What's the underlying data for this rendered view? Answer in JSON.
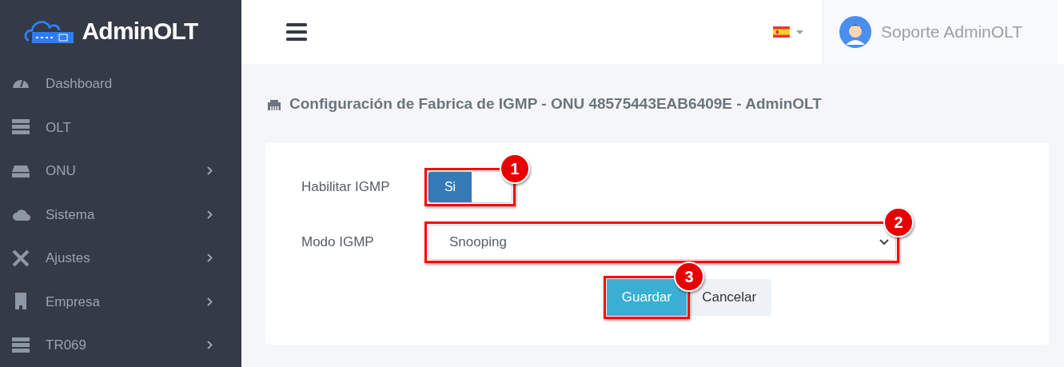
{
  "brand": {
    "name": "AdminOLT"
  },
  "sidebar": {
    "items": [
      {
        "label": "Dashboard",
        "has_submenu": false
      },
      {
        "label": "OLT",
        "has_submenu": false
      },
      {
        "label": "ONU",
        "has_submenu": true
      },
      {
        "label": "Sistema",
        "has_submenu": true
      },
      {
        "label": "Ajustes",
        "has_submenu": true
      },
      {
        "label": "Empresa",
        "has_submenu": true
      },
      {
        "label": "TR069",
        "has_submenu": true
      }
    ]
  },
  "header": {
    "user": "Soporte AdminOLT"
  },
  "page": {
    "title": "Configuración de Fabrica de IGMP - ONU 48575443EAB6409E - AdminOLT"
  },
  "form": {
    "enable": {
      "label": "Habilitar IGMP",
      "on": true,
      "on_text": "Si",
      "annotation": "1"
    },
    "mode": {
      "label": "Modo IGMP",
      "value": "Snooping",
      "annotation": "2"
    },
    "buttons": [
      {
        "label": "Guardar",
        "kind": "primary",
        "annotation": "3"
      },
      {
        "label": "Cancelar",
        "kind": "secondary"
      }
    ]
  }
}
